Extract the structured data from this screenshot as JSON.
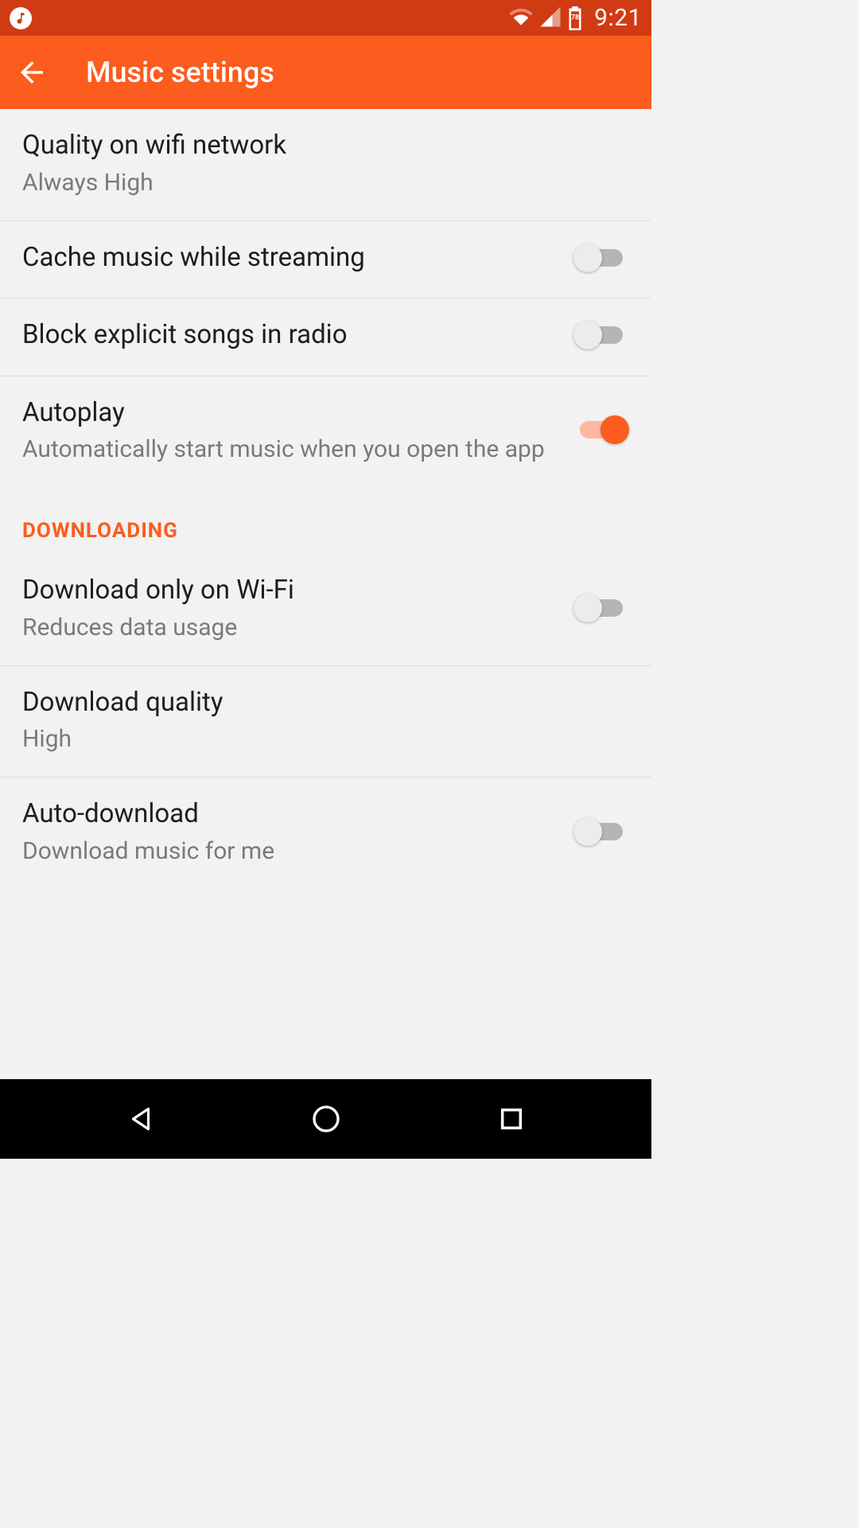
{
  "status": {
    "time": "9:21",
    "battery_level": "78"
  },
  "header": {
    "title": "Music settings"
  },
  "settings": {
    "quality_wifi": {
      "title": "Quality on wifi network",
      "value": "Always High"
    },
    "cache_streaming": {
      "title": "Cache music while streaming",
      "on": false
    },
    "block_explicit": {
      "title": "Block explicit songs in radio",
      "on": false
    },
    "autoplay": {
      "title": "Autoplay",
      "sub": "Automatically start music when you open the app",
      "on": true
    }
  },
  "downloading": {
    "section": "DOWNLOADING",
    "wifi_only": {
      "title": "Download only on Wi-Fi",
      "sub": "Reduces data usage",
      "on": false
    },
    "download_quality": {
      "title": "Download quality",
      "value": "High"
    },
    "auto_download": {
      "title": "Auto-download",
      "sub": "Download music for me",
      "on": false
    }
  }
}
